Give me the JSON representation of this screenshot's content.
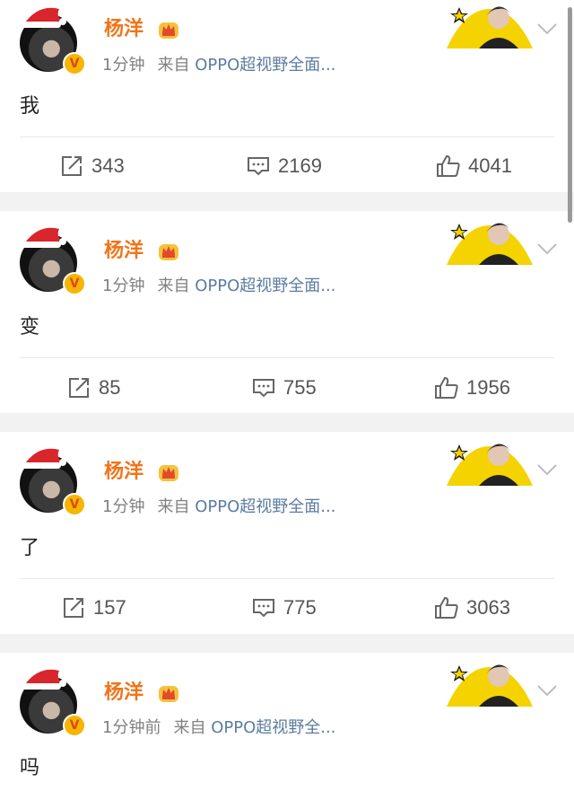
{
  "colors": {
    "page_bg": "#f2f2f2",
    "name": "#f0751a",
    "source_link": "#5c7ca1",
    "meta": "#808080",
    "verified_badge": "#f7b500"
  },
  "posts": [
    {
      "author": "杨洋",
      "time": "1分钟",
      "from_word": "来自",
      "source": "OPPO超视野全面...",
      "text": "我",
      "reposts": "343",
      "comments": "2169",
      "likes": "4041"
    },
    {
      "author": "杨洋",
      "time": "1分钟",
      "from_word": "来自",
      "source": "OPPO超视野全面...",
      "text": "变",
      "reposts": "85",
      "comments": "755",
      "likes": "1956"
    },
    {
      "author": "杨洋",
      "time": "1分钟",
      "from_word": "来自",
      "source": "OPPO超视野全面...",
      "text": "了",
      "reposts": "157",
      "comments": "775",
      "likes": "3063"
    },
    {
      "author": "杨洋",
      "time": "1分钟前",
      "from_word": "来自",
      "source": "OPPO超视野全...",
      "text": "吗"
    }
  ],
  "icons": {
    "avatar": "user-avatar-with-santa-hat",
    "crown": "crown-icon",
    "verified": "verified-v-badge",
    "sticker": "decorative-card-sticker",
    "menu": "chevron-down-icon",
    "repost": "repost-icon",
    "comment": "comment-icon",
    "like": "thumbs-up-icon"
  }
}
